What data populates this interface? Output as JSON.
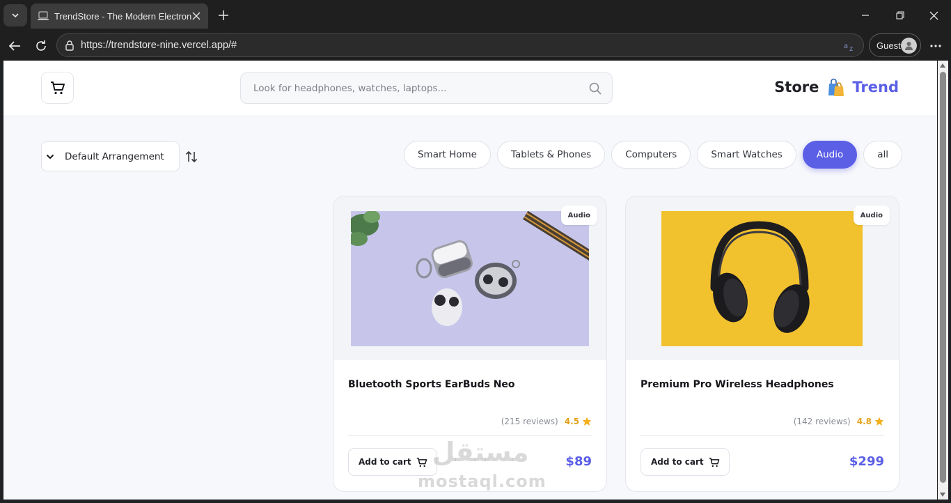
{
  "browser": {
    "tab_title": "TrendStore - The Modern Electronics Store",
    "url": "https://trendstore-nine.vercel.app/#",
    "profile_label": "Guest"
  },
  "header": {
    "search_placeholder": "Look for headphones, watches, laptops...",
    "brand_store": "Store",
    "brand_trend": "Trend"
  },
  "sort": {
    "selected": "Default Arrangement"
  },
  "categories": [
    {
      "label": "Smart Home",
      "active": false
    },
    {
      "label": "Tablets & Phones",
      "active": false
    },
    {
      "label": "Computers",
      "active": false
    },
    {
      "label": "Smart Watches",
      "active": false
    },
    {
      "label": "Audio",
      "active": true
    },
    {
      "label": "all",
      "active": false
    }
  ],
  "products": [
    {
      "badge": "Audio",
      "title": "Bluetooth Sports EarBuds Neo",
      "reviews": "(215 reviews)",
      "rating": "4.5",
      "add_to_cart": "Add to cart",
      "price": "$89"
    },
    {
      "badge": "Audio",
      "title": "Premium Pro Wireless Headphones",
      "reviews": "(142 reviews)",
      "rating": "4.8",
      "add_to_cart": "Add to cart",
      "price": "$299"
    }
  ],
  "watermark": {
    "arabic": "مستقل",
    "latin": "mostaql.com"
  },
  "colors": {
    "accent": "#5b5fe6",
    "rating": "#e4a11b",
    "page_bg": "#f7f8fb"
  }
}
